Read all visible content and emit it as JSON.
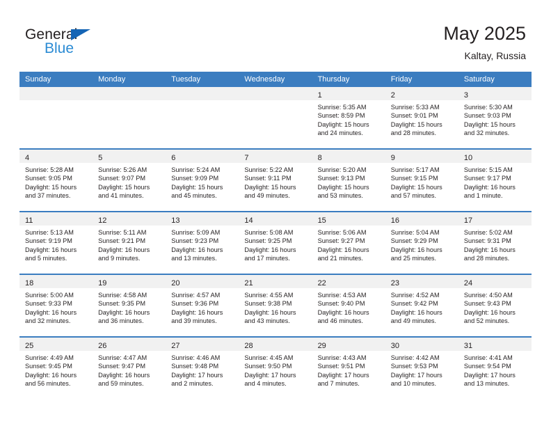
{
  "brand": {
    "name_part1": "General",
    "name_part2": "Blue",
    "triangle_color": "#1565b5",
    "blue_color": "#2b8bd4"
  },
  "header": {
    "title": "May 2025",
    "location": "Kaltay, Russia"
  },
  "theme": {
    "header_bg": "#3b7dc0",
    "header_text": "#ffffff",
    "daynum_band_bg": "#f1f1f1",
    "cell_border": "#3b7dc0",
    "text": "#231f20"
  },
  "weekday_headers": [
    "Sunday",
    "Monday",
    "Tuesday",
    "Wednesday",
    "Thursday",
    "Friday",
    "Saturday"
  ],
  "weeks": [
    [
      {
        "day": "",
        "empty": true
      },
      {
        "day": "",
        "empty": true
      },
      {
        "day": "",
        "empty": true
      },
      {
        "day": "",
        "empty": true
      },
      {
        "day": "1",
        "sunrise": "Sunrise: 5:35 AM",
        "sunset": "Sunset: 8:59 PM",
        "daylight1": "Daylight: 15 hours",
        "daylight2": "and 24 minutes."
      },
      {
        "day": "2",
        "sunrise": "Sunrise: 5:33 AM",
        "sunset": "Sunset: 9:01 PM",
        "daylight1": "Daylight: 15 hours",
        "daylight2": "and 28 minutes."
      },
      {
        "day": "3",
        "sunrise": "Sunrise: 5:30 AM",
        "sunset": "Sunset: 9:03 PM",
        "daylight1": "Daylight: 15 hours",
        "daylight2": "and 32 minutes."
      }
    ],
    [
      {
        "day": "4",
        "sunrise": "Sunrise: 5:28 AM",
        "sunset": "Sunset: 9:05 PM",
        "daylight1": "Daylight: 15 hours",
        "daylight2": "and 37 minutes."
      },
      {
        "day": "5",
        "sunrise": "Sunrise: 5:26 AM",
        "sunset": "Sunset: 9:07 PM",
        "daylight1": "Daylight: 15 hours",
        "daylight2": "and 41 minutes."
      },
      {
        "day": "6",
        "sunrise": "Sunrise: 5:24 AM",
        "sunset": "Sunset: 9:09 PM",
        "daylight1": "Daylight: 15 hours",
        "daylight2": "and 45 minutes."
      },
      {
        "day": "7",
        "sunrise": "Sunrise: 5:22 AM",
        "sunset": "Sunset: 9:11 PM",
        "daylight1": "Daylight: 15 hours",
        "daylight2": "and 49 minutes."
      },
      {
        "day": "8",
        "sunrise": "Sunrise: 5:20 AM",
        "sunset": "Sunset: 9:13 PM",
        "daylight1": "Daylight: 15 hours",
        "daylight2": "and 53 minutes."
      },
      {
        "day": "9",
        "sunrise": "Sunrise: 5:17 AM",
        "sunset": "Sunset: 9:15 PM",
        "daylight1": "Daylight: 15 hours",
        "daylight2": "and 57 minutes."
      },
      {
        "day": "10",
        "sunrise": "Sunrise: 5:15 AM",
        "sunset": "Sunset: 9:17 PM",
        "daylight1": "Daylight: 16 hours",
        "daylight2": "and 1 minute."
      }
    ],
    [
      {
        "day": "11",
        "sunrise": "Sunrise: 5:13 AM",
        "sunset": "Sunset: 9:19 PM",
        "daylight1": "Daylight: 16 hours",
        "daylight2": "and 5 minutes."
      },
      {
        "day": "12",
        "sunrise": "Sunrise: 5:11 AM",
        "sunset": "Sunset: 9:21 PM",
        "daylight1": "Daylight: 16 hours",
        "daylight2": "and 9 minutes."
      },
      {
        "day": "13",
        "sunrise": "Sunrise: 5:09 AM",
        "sunset": "Sunset: 9:23 PM",
        "daylight1": "Daylight: 16 hours",
        "daylight2": "and 13 minutes."
      },
      {
        "day": "14",
        "sunrise": "Sunrise: 5:08 AM",
        "sunset": "Sunset: 9:25 PM",
        "daylight1": "Daylight: 16 hours",
        "daylight2": "and 17 minutes."
      },
      {
        "day": "15",
        "sunrise": "Sunrise: 5:06 AM",
        "sunset": "Sunset: 9:27 PM",
        "daylight1": "Daylight: 16 hours",
        "daylight2": "and 21 minutes."
      },
      {
        "day": "16",
        "sunrise": "Sunrise: 5:04 AM",
        "sunset": "Sunset: 9:29 PM",
        "daylight1": "Daylight: 16 hours",
        "daylight2": "and 25 minutes."
      },
      {
        "day": "17",
        "sunrise": "Sunrise: 5:02 AM",
        "sunset": "Sunset: 9:31 PM",
        "daylight1": "Daylight: 16 hours",
        "daylight2": "and 28 minutes."
      }
    ],
    [
      {
        "day": "18",
        "sunrise": "Sunrise: 5:00 AM",
        "sunset": "Sunset: 9:33 PM",
        "daylight1": "Daylight: 16 hours",
        "daylight2": "and 32 minutes."
      },
      {
        "day": "19",
        "sunrise": "Sunrise: 4:58 AM",
        "sunset": "Sunset: 9:35 PM",
        "daylight1": "Daylight: 16 hours",
        "daylight2": "and 36 minutes."
      },
      {
        "day": "20",
        "sunrise": "Sunrise: 4:57 AM",
        "sunset": "Sunset: 9:36 PM",
        "daylight1": "Daylight: 16 hours",
        "daylight2": "and 39 minutes."
      },
      {
        "day": "21",
        "sunrise": "Sunrise: 4:55 AM",
        "sunset": "Sunset: 9:38 PM",
        "daylight1": "Daylight: 16 hours",
        "daylight2": "and 43 minutes."
      },
      {
        "day": "22",
        "sunrise": "Sunrise: 4:53 AM",
        "sunset": "Sunset: 9:40 PM",
        "daylight1": "Daylight: 16 hours",
        "daylight2": "and 46 minutes."
      },
      {
        "day": "23",
        "sunrise": "Sunrise: 4:52 AM",
        "sunset": "Sunset: 9:42 PM",
        "daylight1": "Daylight: 16 hours",
        "daylight2": "and 49 minutes."
      },
      {
        "day": "24",
        "sunrise": "Sunrise: 4:50 AM",
        "sunset": "Sunset: 9:43 PM",
        "daylight1": "Daylight: 16 hours",
        "daylight2": "and 52 minutes."
      }
    ],
    [
      {
        "day": "25",
        "sunrise": "Sunrise: 4:49 AM",
        "sunset": "Sunset: 9:45 PM",
        "daylight1": "Daylight: 16 hours",
        "daylight2": "and 56 minutes."
      },
      {
        "day": "26",
        "sunrise": "Sunrise: 4:47 AM",
        "sunset": "Sunset: 9:47 PM",
        "daylight1": "Daylight: 16 hours",
        "daylight2": "and 59 minutes."
      },
      {
        "day": "27",
        "sunrise": "Sunrise: 4:46 AM",
        "sunset": "Sunset: 9:48 PM",
        "daylight1": "Daylight: 17 hours",
        "daylight2": "and 2 minutes."
      },
      {
        "day": "28",
        "sunrise": "Sunrise: 4:45 AM",
        "sunset": "Sunset: 9:50 PM",
        "daylight1": "Daylight: 17 hours",
        "daylight2": "and 4 minutes."
      },
      {
        "day": "29",
        "sunrise": "Sunrise: 4:43 AM",
        "sunset": "Sunset: 9:51 PM",
        "daylight1": "Daylight: 17 hours",
        "daylight2": "and 7 minutes."
      },
      {
        "day": "30",
        "sunrise": "Sunrise: 4:42 AM",
        "sunset": "Sunset: 9:53 PM",
        "daylight1": "Daylight: 17 hours",
        "daylight2": "and 10 minutes."
      },
      {
        "day": "31",
        "sunrise": "Sunrise: 4:41 AM",
        "sunset": "Sunset: 9:54 PM",
        "daylight1": "Daylight: 17 hours",
        "daylight2": "and 13 minutes."
      }
    ]
  ]
}
